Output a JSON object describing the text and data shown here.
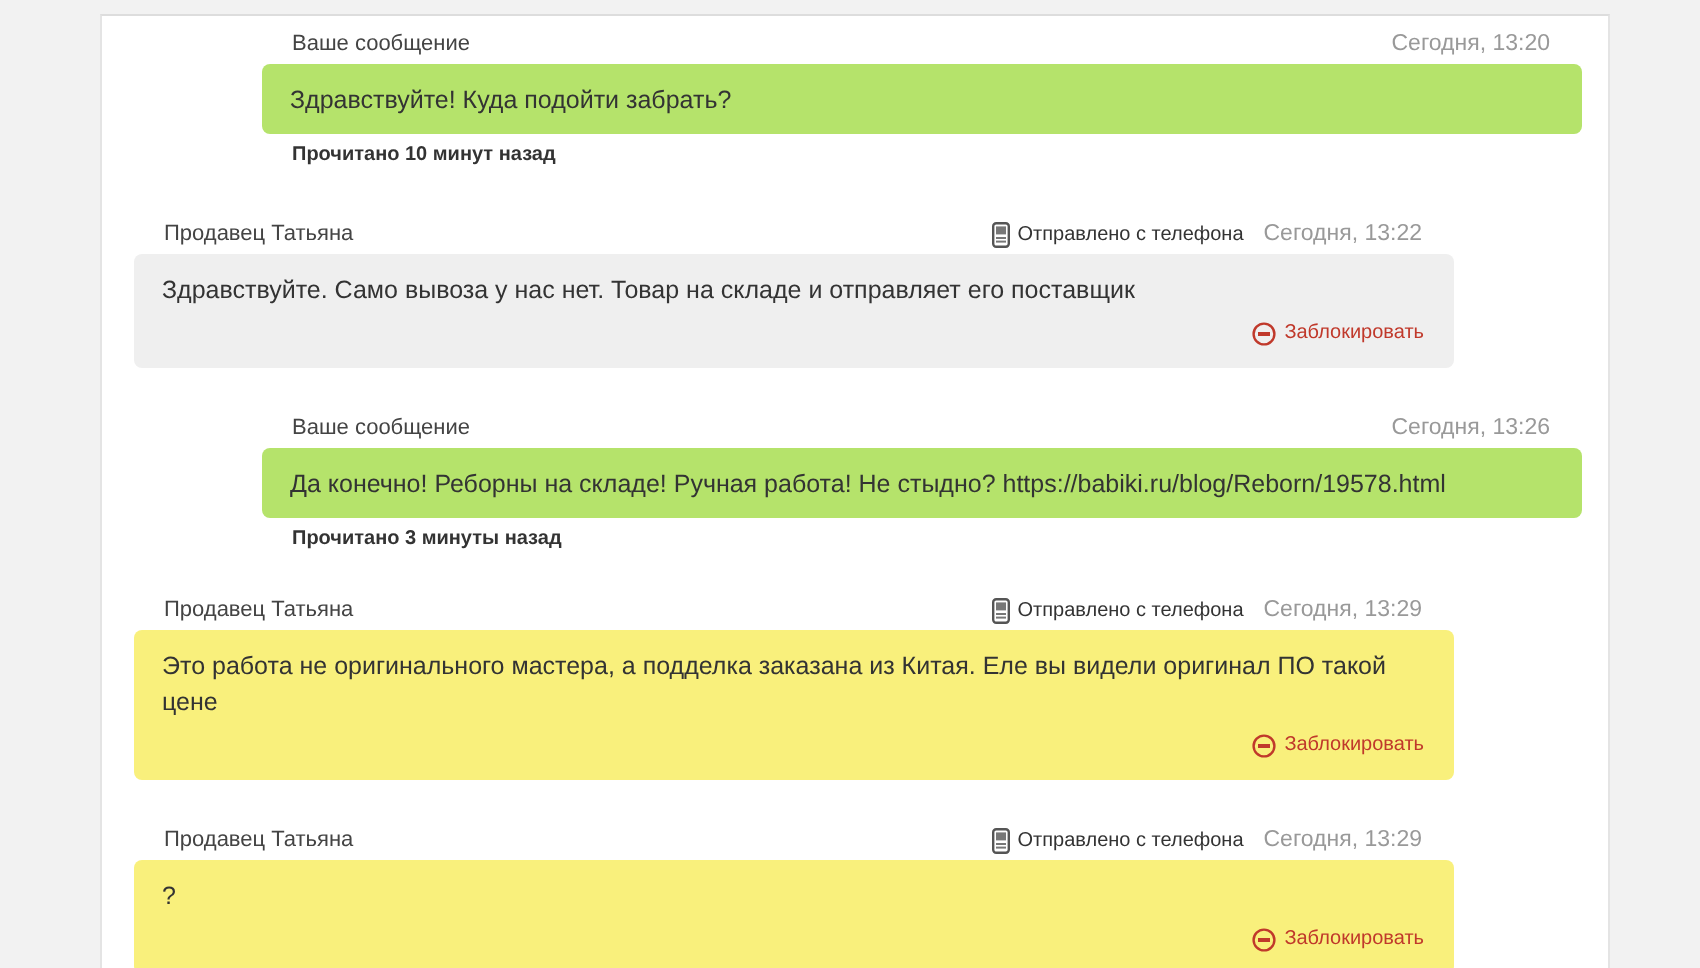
{
  "messages": [
    {
      "kind": "outgoing",
      "sender": "Ваше сообщение",
      "time": "Сегодня, 13:20",
      "text": "Здравствуйте! Куда подойти забрать?",
      "color": "#b5e36b",
      "read_status": "Прочитано 10 минут назад"
    },
    {
      "kind": "incoming",
      "sender": "Продавец Татьяна",
      "sent_via": "Отправлено с телефона",
      "time": "Сегодня, 13:22",
      "text": "Здравствуйте. Само вывоза у нас нет. Товар на складе и отправляет его поставщик",
      "color": "#efefef",
      "action": "Заблокировать"
    },
    {
      "kind": "outgoing",
      "sender": "Ваше сообщение",
      "time": "Сегодня, 13:26",
      "text": "Да конечно! Реборны на складе! Ручная работа! Не стыдно? https://babiki.ru/blog/Reborn/19578.html",
      "color": "#b5e36b",
      "read_status": "Прочитано 3 минуты назад"
    },
    {
      "kind": "incoming",
      "sender": "Продавец Татьяна",
      "sent_via": "Отправлено с телефона",
      "time": "Сегодня, 13:29",
      "text": "Это работа не оригинального мастера, а подделка заказана из Китая. Еле вы видели оригинал ПО такой цене",
      "color": "#f9f07c",
      "action": "Заблокировать"
    },
    {
      "kind": "incoming",
      "sender": "Продавец Татьяна",
      "sent_via": "Отправлено с телефона",
      "time": "Сегодня, 13:29",
      "text": "?",
      "color": "#f9f07c",
      "action": "Заблокировать"
    }
  ]
}
